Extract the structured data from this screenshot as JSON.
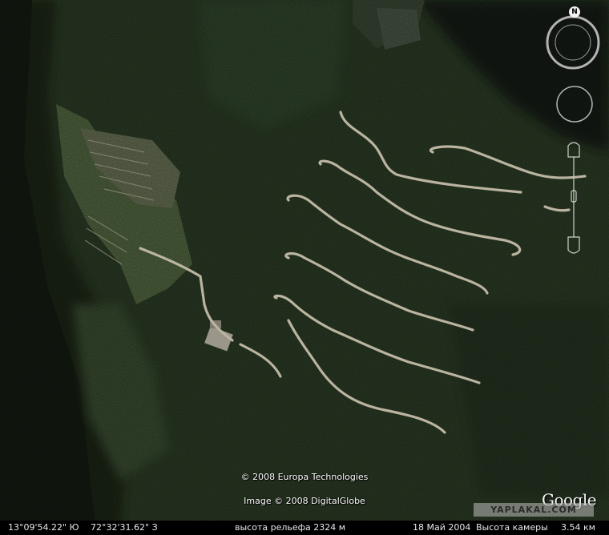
{
  "map": {
    "credit_line_1": "© 2008 Europa Technologies",
    "credit_line_2": "Image © 2008 DigitalGlobe",
    "logo_text": "Google",
    "watermark_text": "YAPLAKAL.COM"
  },
  "navigation": {
    "north_label": "N",
    "icons": [
      "compass-eye-icon",
      "look-joystick-icon",
      "zoom-slider-icon"
    ]
  },
  "status_bar": {
    "latitude": "13°09'54.22\" Ю",
    "longitude": "72°32'31.62\" З",
    "elevation": "высота рельефа 2324 м",
    "image_date": "18 Май 2004",
    "eye_altitude_label": "Высота камеры",
    "eye_altitude_value": "3.54 км"
  },
  "colors": {
    "forest": "#2c3d26",
    "dark_forest": "#1c2718",
    "road": "#b8b3a0",
    "status_bar": "#000000"
  }
}
